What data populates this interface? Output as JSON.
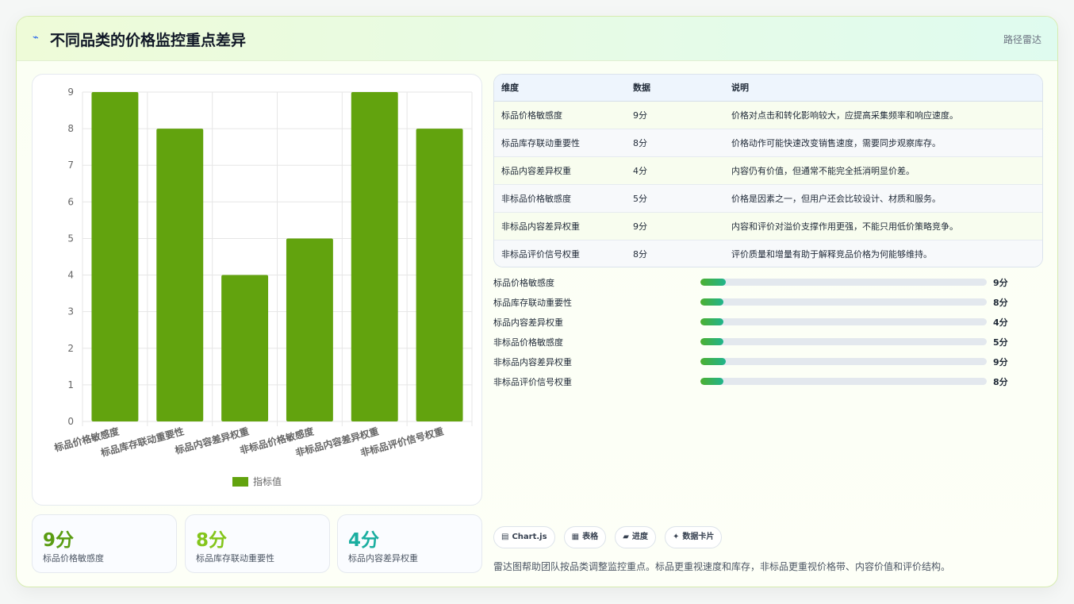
{
  "header": {
    "icon": "pulse-icon",
    "title": "不同品类的价格监控重点差异",
    "tag": "路径雷达"
  },
  "colors": {
    "bar": "#62a30e",
    "accent_green": "#5a9c12",
    "accent_lime": "#84c51c",
    "accent_teal": "#1aaea0"
  },
  "chart_data": {
    "type": "bar",
    "categories": [
      "标品价格敏感度",
      "标品库存联动重要性",
      "标品内容差异权重",
      "非标品价格敏感度",
      "非标品内容差异权重",
      "非标品评价信号权重"
    ],
    "series": [
      {
        "name": "指标值",
        "values": [
          9,
          8,
          4,
          5,
          9,
          8
        ]
      }
    ],
    "ylim": [
      0,
      9
    ],
    "yticks": [
      0,
      1,
      2,
      3,
      4,
      5,
      6,
      7,
      8,
      9
    ],
    "grid": true,
    "legend": "bottom"
  },
  "stats": [
    {
      "value": "9分",
      "label": "标品价格敏感度"
    },
    {
      "value": "8分",
      "label": "标品库存联动重要性"
    },
    {
      "value": "4分",
      "label": "标品内容差异权重"
    }
  ],
  "table": {
    "headers": [
      "维度",
      "数据",
      "说明"
    ],
    "rows": [
      [
        "标品价格敏感度",
        "9分",
        "价格对点击和转化影响较大，应提高采集频率和响应速度。"
      ],
      [
        "标品库存联动重要性",
        "8分",
        "价格动作可能快速改变销售速度，需要同步观察库存。"
      ],
      [
        "标品内容差异权重",
        "4分",
        "内容仍有价值，但通常不能完全抵消明显价差。"
      ],
      [
        "非标品价格敏感度",
        "5分",
        "价格是因素之一，但用户还会比较设计、材质和服务。"
      ],
      [
        "非标品内容差异权重",
        "9分",
        "内容和评价对溢价支撑作用更强，不能只用低价策略竞争。"
      ],
      [
        "非标品评价信号权重",
        "8分",
        "评价质量和增量有助于解释竞品价格为何能够维持。"
      ]
    ]
  },
  "progress": [
    {
      "name": "标品价格敏感度",
      "score": "9分",
      "fraction": 0.09
    },
    {
      "name": "标品库存联动重要性",
      "score": "8分",
      "fraction": 0.08
    },
    {
      "name": "标品内容差异权重",
      "score": "4分",
      "fraction": 0.08
    },
    {
      "name": "非标品价格敏感度",
      "score": "5分",
      "fraction": 0.08
    },
    {
      "name": "非标品内容差异权重",
      "score": "9分",
      "fraction": 0.09
    },
    {
      "name": "非标品评价信号权重",
      "score": "8分",
      "fraction": 0.08
    }
  ],
  "chips": [
    {
      "icon": "chart-icon",
      "glyph": "▤",
      "label": "Chart.js"
    },
    {
      "icon": "table-icon",
      "glyph": "▦",
      "label": "表格"
    },
    {
      "icon": "progress-icon",
      "glyph": "▰",
      "label": "进度"
    },
    {
      "icon": "sparkle-icon",
      "glyph": "✦",
      "label": "数据卡片"
    }
  ],
  "caption": "雷达图帮助团队按品类调整监控重点。标品更重视速度和库存，非标品更重视价格带、内容价值和评价结构。"
}
